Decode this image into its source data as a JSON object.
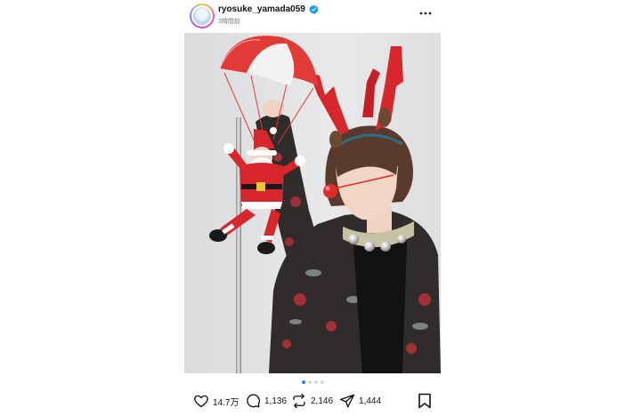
{
  "post": {
    "username": "ryosuke_yamada059",
    "timestamp": "3時間前",
    "verified": true,
    "more_icon": "more-horizontal-icon"
  },
  "photo": {
    "description_icon": "post-photo",
    "carousel": {
      "count": 4,
      "active_index": 0
    }
  },
  "actions": {
    "likes": "14.7万",
    "comments": "1,136",
    "reposts": "2,146",
    "shares": "1,444"
  },
  "colors": {
    "verified_blue": "#1d9bf0",
    "dot_active": "#2f80ed",
    "dot_inactive": "#cfd8dc",
    "background": "#ffffff"
  }
}
